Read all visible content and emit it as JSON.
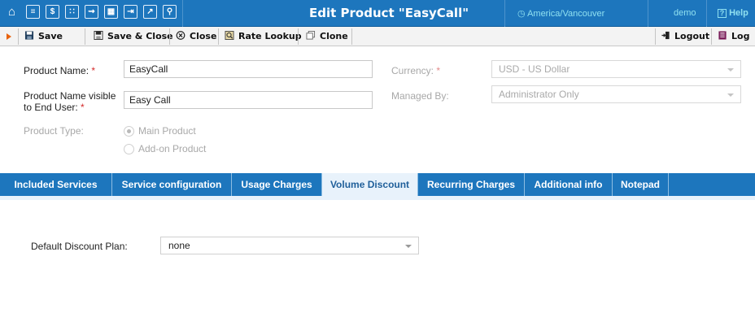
{
  "titlebar": {
    "title": "Edit Product \"EasyCall\"",
    "timezone": "America/Vancouver",
    "user": "demo",
    "help": "Help",
    "icons": [
      "home-icon",
      "list-icon",
      "billing-icon",
      "grid-icon",
      "person-icon",
      "product-icon",
      "exit-icon",
      "chart-icon",
      "search-icon"
    ]
  },
  "toolbar": {
    "save": "Save",
    "save_close": "Save & Close",
    "close": "Close",
    "rate_lookup": "Rate Lookup",
    "clone": "Clone",
    "logout": "Logout",
    "log": "Log"
  },
  "form": {
    "product_name_label": "Product Name:",
    "product_name_value": "EasyCall",
    "visible_name_label_1": "Product Name visible",
    "visible_name_label_2": "to End User:",
    "visible_name_value": "Easy Call",
    "required_mark": "*",
    "currency_label": "Currency:",
    "currency_value": "USD - US Dollar",
    "managed_by_label": "Managed By:",
    "managed_by_value": "Administrator Only",
    "product_type_label": "Product Type:",
    "product_type_options": [
      "Main Product",
      "Add-on Product"
    ],
    "product_type_selected": "Main Product"
  },
  "tabs": [
    {
      "label": "Included Services"
    },
    {
      "label": "Service configuration"
    },
    {
      "label": "Usage Charges"
    },
    {
      "label": "Volume Discount"
    },
    {
      "label": "Recurring Charges"
    },
    {
      "label": "Additional info"
    },
    {
      "label": "Notepad"
    }
  ],
  "active_tab": "Volume Discount",
  "volume_discount": {
    "label": "Default Discount Plan:",
    "value": "none"
  },
  "colors": {
    "header_blue": "#1d76bd",
    "required_red": "#d42a2a",
    "accent_orange": "#e8620c"
  }
}
